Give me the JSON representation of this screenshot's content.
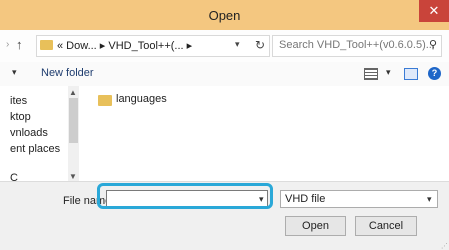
{
  "window": {
    "title": "Open",
    "close_symbol": "✕"
  },
  "address": {
    "breadcrumb": "« Dow... ▸ VHD_Tool++(... ▸",
    "search_placeholder": "Search VHD_Tool++(v0.6.0.5)..."
  },
  "toolbar": {
    "new_folder": "New folder"
  },
  "nav_pane": {
    "items": [
      "ites",
      "ktop",
      "vnloads",
      "ent places",
      "C"
    ]
  },
  "files": [
    {
      "name": "languages"
    }
  ],
  "bottom": {
    "file_name_label": "File name:",
    "file_name_value": "",
    "file_type": "VHD file",
    "open_label": "Open",
    "cancel_label": "Cancel"
  }
}
